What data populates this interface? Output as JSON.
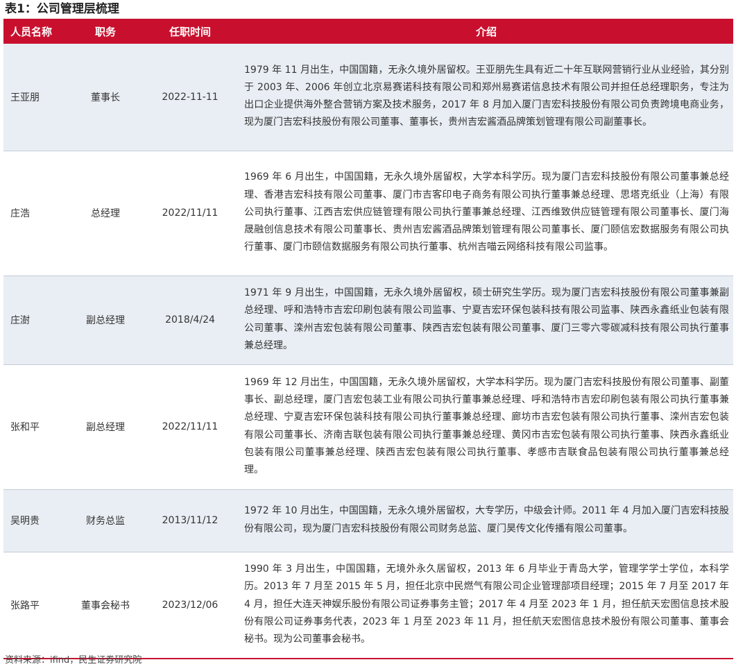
{
  "title": "表1：公司管理层梳理",
  "table": {
    "headers": [
      "人员名称",
      "职务",
      "任职时间",
      "介绍"
    ],
    "rows": [
      {
        "name": "王亚朋",
        "position": "董事长",
        "date": "2022-11-11",
        "intro": "1979 年 11 月出生，中国国籍，无永久境外居留权。王亚朋先生具有近二十年互联网营销行业从业经验，其分别于 2003 年、2006 年创立北京易赛诺科技有限公司和郑州易赛诺信息技术有限公司并担任总经理职务，专注为出口企业提供海外整合营销方案及技术服务，2017 年 8 月加入厦门吉宏科技股份有限公司负责跨境电商业务，现为厦门吉宏科技股份有限公司董事、董事长，贵州吉宏酱酒品牌策划管理有限公司副董事长。"
      },
      {
        "name": "庄浩",
        "position": "总经理",
        "date": "2022/11/11",
        "intro": "1969 年 6 月出生，中国国籍，无永久境外居留权，大学本科学历。现为厦门吉宏科技股份有限公司董事兼总经理、香港吉宏科技有限公司董事、厦门市吉客印电子商务有限公司执行董事兼总经理、思塔克纸业（上海）有限公司执行董事、江西吉宏供应链管理有限公司执行董事兼总经理、江西维致供应链管理有限公司董事长、厦门海晟融创信息技术有限公司董事长、贵州吉宏酱酒品牌策划管理有限公司董事长、厦门颐信宏数据服务有限公司执行董事、厦门市颐信数据服务有限公司执行董事、杭州吉喵云网络科技有限公司监事。"
      },
      {
        "name": "庄澍",
        "position": "副总经理",
        "date": "2018/4/24",
        "intro": "1971 年 9 月出生，中国国籍，无永久境外居留权，硕士研究生学历。现为厦门吉宏科技股份有限公司董事兼副总经理、呼和浩特市吉宏印刷包装有限公司监事、宁夏吉宏环保包装科技有限公司监事、陕西永鑫纸业包装有限公司董事、滦州吉宏包装有限公司董事、陕西吉宏包装有限公司董事、厦门三零六零碳减科技有限公司执行董事兼总经理。"
      },
      {
        "name": "张和平",
        "position": "副总经理",
        "date": "2022/11/11",
        "intro": "1969 年 12 月出生，中国国籍，无永久境外居留权，大学本科学历。现为厦门吉宏科技股份有限公司董事、副董事长、副总经理，厦门吉宏包装工业有限公司执行董事兼总经理、呼和浩特市吉宏印刷包装有限公司执行董事兼总经理、宁夏吉宏环保包装科技有限公司执行董事兼总经理、廊坊市吉宏包装有限公司执行董事、滦州吉宏包装有限公司董事长、济南吉联包装有限公司执行董事兼总经理、黄冈市吉宏包装有限公司执行董事、陕西永鑫纸业包装有限公司董事兼总经理、陕西吉宏包装有限公司执行董事、孝感市吉联食品包装有限公司执行董事兼总经理。"
      },
      {
        "name": "吴明贵",
        "position": "财务总监",
        "date": "2013/11/12",
        "intro": "1972 年 10 月出生，中国国籍，无永久境外居留权，大专学历，中级会计师。2011 年 4 月加入厦门吉宏科技股份有限公司，现为厦门吉宏科技股份有限公司财务总监、厦门昊传文化传播有限公司董事。"
      },
      {
        "name": "张路平",
        "position": "董事会秘书",
        "date": "2023/12/06",
        "intro": "1990 年 3 月出生，中国国籍，无境外永久居留权，2013 年 6 月毕业于青岛大学，管理学学士学位，本科学历。2013 年 7 月至 2015 年 5 月，担任北京中民燃气有限公司企业管理部项目经理；2015 年 7 月至 2017 年 4 月，担任大连天神娱乐股份有限公司证券事务主管；2017 年 4 月至 2023 年 1 月，担任航天宏图信息技术股份有限公司证券事务代表，2023 年 1 月至 2023 年 11 月，担任航天宏图信息技术股份有限公司董事、董事会秘书。现为公司董事会秘书。"
      }
    ]
  },
  "source": "资料来源：ifind，民生证券研究院",
  "colors": {
    "header_bg": "#c8102e",
    "alt_row_bg": "#e9eef4"
  }
}
